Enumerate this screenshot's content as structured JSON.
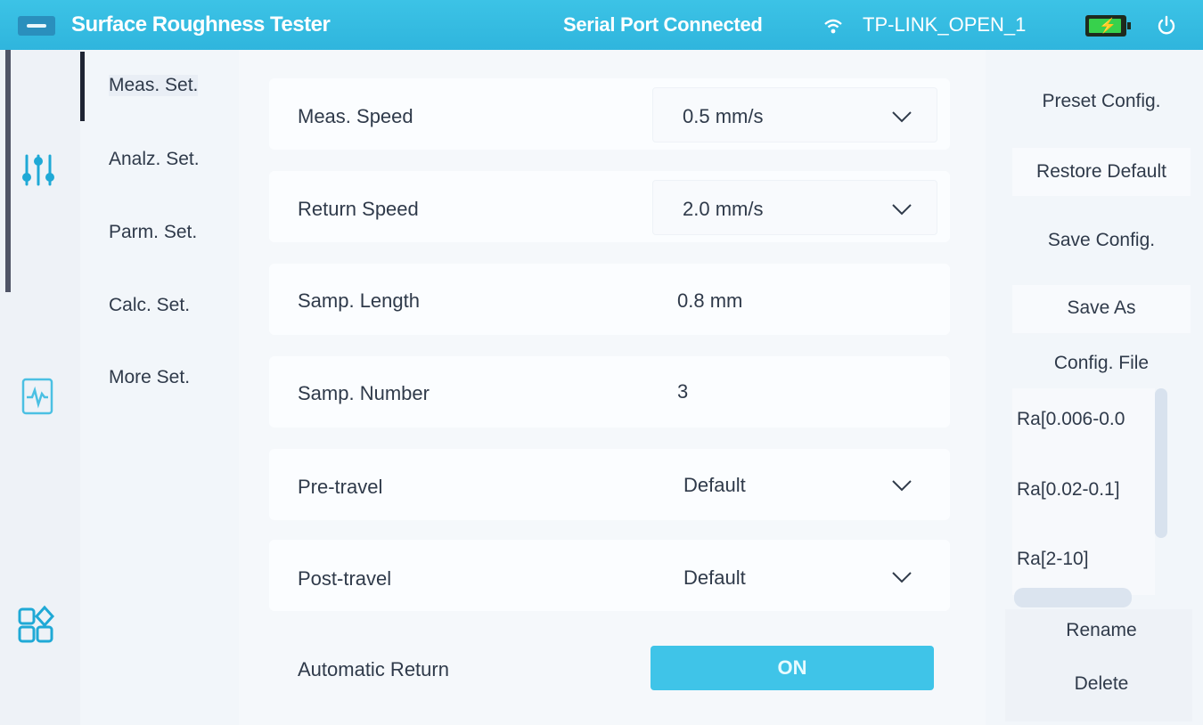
{
  "topbar": {
    "app_title": "Surface Roughness Tester",
    "serial_status": "Serial Port Connected",
    "wifi_ssid": "TP-LINK_OPEN_1",
    "icons": [
      "menu-icon",
      "wifi-icon",
      "battery-icon",
      "power-icon"
    ]
  },
  "rail": {
    "items": [
      {
        "name": "settings-sliders-icon",
        "selected": true
      },
      {
        "name": "report-waveform-icon",
        "selected": false
      },
      {
        "name": "apps-grid-icon",
        "selected": false
      }
    ]
  },
  "categories": [
    {
      "label": "Meas. Set.",
      "active": true
    },
    {
      "label": "Analz. Set.",
      "active": false
    },
    {
      "label": "Parm. Set.",
      "active": false
    },
    {
      "label": "Calc. Set.",
      "active": false
    },
    {
      "label": "More Set.",
      "active": false
    }
  ],
  "settings": {
    "meas_speed": {
      "label": "Meas. Speed",
      "value": "0.5 mm/s"
    },
    "return_speed": {
      "label": "Return Speed",
      "value": "2.0 mm/s"
    },
    "samp_length": {
      "label": "Samp. Length",
      "value": "0.8 mm"
    },
    "samp_number": {
      "label": "Samp. Number",
      "value": "3"
    },
    "pre_travel": {
      "label": "Pre-travel",
      "value": "Default"
    },
    "post_travel": {
      "label": "Post-travel",
      "value": "Default"
    },
    "automatic_return": {
      "label": "Automatic Return",
      "value": "ON"
    }
  },
  "right_panel": {
    "preset_config": "Preset Config.",
    "restore_default": "Restore Default",
    "save_config": "Save Config.",
    "save_as": "Save As",
    "config_file_title": "Config. File",
    "config_files": [
      "Ra[0.006-0.0",
      "Ra[0.02-0.1]",
      "Ra[2-10]"
    ],
    "rename": "Rename",
    "delete": "Delete"
  },
  "colors": {
    "accent": "#2fb5dd",
    "toggle_on": "#3fc4e8",
    "battery": "#37d14c",
    "text": "#2f3a4a"
  }
}
